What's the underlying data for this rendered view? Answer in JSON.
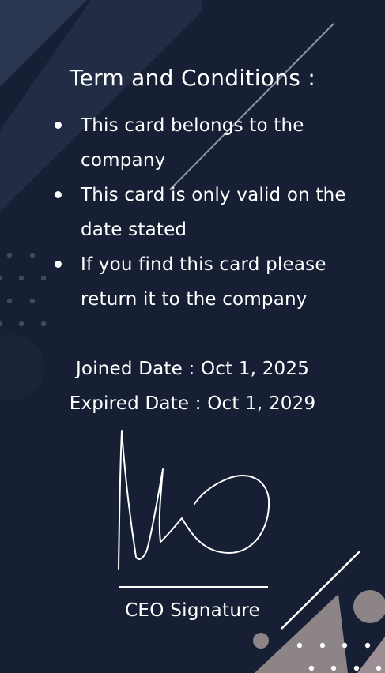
{
  "card": {
    "title": "Term and Conditions :",
    "terms": [
      "This card belongs to the company",
      "This card is only valid on the date stated",
      "If you find this card please return it to the company"
    ],
    "joined_date": "Joined Date : Oct 1, 2025",
    "expired_date": "Expired Date : Oct 1,  2029",
    "signature_label": "CEO Signature"
  },
  "colors": {
    "background": "#161f33",
    "accent_panel": "#25304a",
    "text": "#ffffff",
    "taupe": "#9b8f95"
  }
}
